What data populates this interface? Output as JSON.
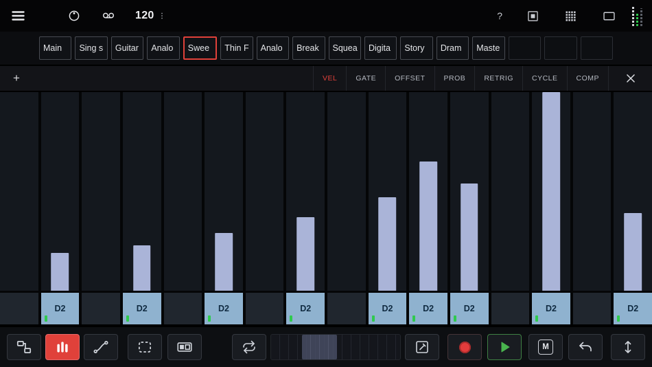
{
  "colors": {
    "accent_red": "#e0413a",
    "velocity_bar": "#aab4d8",
    "note_cell_blue": "#8fb2cf",
    "led_green": "#2fca4e",
    "play_green": "#49b44e",
    "record_red": "#e23c3c"
  },
  "icons": {
    "menu": "hamburger",
    "link": "circle-with-dot",
    "recorder": "two-reels",
    "tempo_menu": "kebab-dots",
    "help": "?",
    "window": "square-in-square",
    "grid": "4x4-dots",
    "display": "screen-rect",
    "close": "x-cross",
    "loop": "cycle-arrows",
    "undo": "curved-left-arrow",
    "vertical_zoom": "up-down-arrow"
  },
  "topbar": {
    "tempo": "120",
    "help": "?"
  },
  "track_tabs": [
    {
      "label": "Main"
    },
    {
      "label": "Sing s"
    },
    {
      "label": "Guitar"
    },
    {
      "label": "Analo"
    },
    {
      "label": "Swee",
      "selected": true
    },
    {
      "label": "Thin F"
    },
    {
      "label": "Analo"
    },
    {
      "label": "Break"
    },
    {
      "label": "Squea"
    },
    {
      "label": "Digita"
    },
    {
      "label": "Story"
    },
    {
      "label": "Dram"
    },
    {
      "label": "Maste"
    },
    {
      "label": ""
    },
    {
      "label": ""
    },
    {
      "label": ""
    }
  ],
  "edit_bar": {
    "add": "+",
    "tabs": [
      {
        "label": "VEL",
        "selected": true
      },
      {
        "label": "GATE"
      },
      {
        "label": "OFFSET"
      },
      {
        "label": "PROB"
      },
      {
        "label": "RETRIG"
      },
      {
        "label": "CYCLE"
      },
      {
        "label": "COMP"
      }
    ]
  },
  "sequencer": {
    "lanes": 16,
    "edit_mode": "VEL",
    "steps": [
      {
        "step": 1,
        "active": false
      },
      {
        "step": 2,
        "active": true,
        "note": "D2",
        "velocity": 24,
        "bar_height_pct": 19
      },
      {
        "step": 3,
        "active": false
      },
      {
        "step": 4,
        "active": true,
        "note": "D2",
        "velocity": 29,
        "bar_height_pct": 23
      },
      {
        "step": 5,
        "active": false
      },
      {
        "step": 6,
        "active": true,
        "note": "D2",
        "velocity": 37,
        "bar_height_pct": 29
      },
      {
        "step": 7,
        "active": false
      },
      {
        "step": 8,
        "active": true,
        "note": "D2",
        "velocity": 47,
        "bar_height_pct": 37
      },
      {
        "step": 9,
        "active": false
      },
      {
        "step": 10,
        "active": true,
        "note": "D2",
        "velocity": 60,
        "bar_height_pct": 47
      },
      {
        "step": 11,
        "active": true,
        "note": "D2",
        "velocity": 83,
        "bar_height_pct": 65
      },
      {
        "step": 12,
        "active": true,
        "note": "D2",
        "velocity": 69,
        "bar_height_pct": 54
      },
      {
        "step": 13,
        "active": false
      },
      {
        "step": 14,
        "active": true,
        "note": "D2",
        "velocity": 127,
        "bar_height_pct": 100
      },
      {
        "step": 15,
        "active": false
      },
      {
        "step": 16,
        "active": true,
        "note": "D2",
        "velocity": 50,
        "bar_height_pct": 39
      }
    ]
  },
  "transport": {
    "mute_label": "M",
    "timeline": {
      "viewport_left_pct": 24,
      "viewport_width_pct": 27
    }
  }
}
